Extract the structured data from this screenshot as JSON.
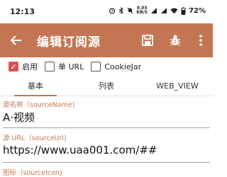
{
  "status": {
    "time": "12:13",
    "speed_value": "0.03",
    "speed_unit": "KB/S",
    "battery": "72%"
  },
  "appbar": {
    "title": "编辑订阅源",
    "color": "#c47654"
  },
  "checks": [
    {
      "label": "启用",
      "checked": true
    },
    {
      "label": "单 URL",
      "checked": false
    },
    {
      "label": "CookieJar",
      "checked": false
    }
  ],
  "tabs": [
    {
      "label": "基本",
      "active": true
    },
    {
      "label": "列表",
      "active": false
    },
    {
      "label": "WEB_VIEW",
      "active": false
    }
  ],
  "fields": {
    "source_name": {
      "label": "源名称（sourceName)",
      "value": "A·视频"
    },
    "source_url": {
      "label": "源 URL（sourceUrl)",
      "value": "https://www.uaa001.com/##"
    },
    "source_icon": {
      "label": "图标（sourceIcon)"
    }
  }
}
